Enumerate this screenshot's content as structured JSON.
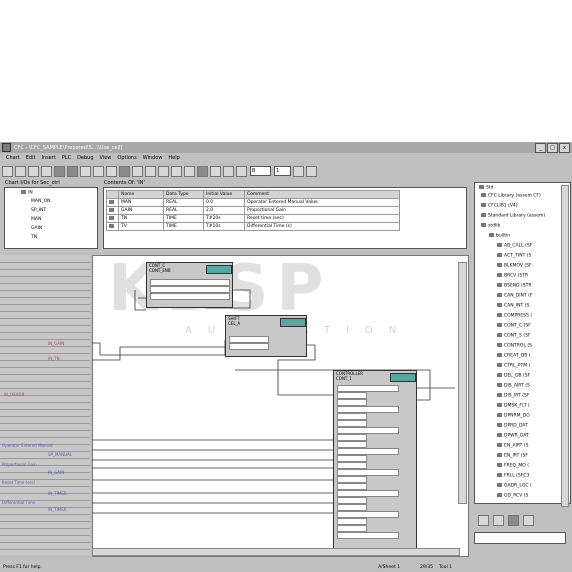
{
  "window": {
    "title": "CFC - \\CFC_SAMPLE\\Prepared\\S...\\\\Use_cell]",
    "controls": [
      "_",
      "□",
      "x"
    ]
  },
  "menu": [
    "Chart",
    "Edit",
    "Insert",
    "PLC",
    "Debug",
    "View",
    "Options",
    "Window",
    "Help"
  ],
  "toolbar": {
    "combo1": "B",
    "combo2": "1"
  },
  "chart_panel": {
    "label": "Chart I/Os for Sec_ctrl",
    "items": [
      "MAN_ON",
      "SP_INT",
      "MAN",
      "GAIN",
      "TN"
    ]
  },
  "contents_panel": {
    "label": "Contents Of: 'IN'",
    "columns": [
      "Name",
      "Data Type",
      "Initial Value",
      "Comment"
    ],
    "rows": [
      [
        "MAN",
        "REAL",
        "0.0",
        "Operator Entered Manual Value"
      ],
      [
        "GAIN",
        "REAL",
        "2.0",
        "Proportional Gain"
      ],
      [
        "TN",
        "TIME",
        "T#20s",
        "Reset time (sec)"
      ],
      [
        "TV",
        "TIME",
        "T#10s",
        "Differential Time (s)"
      ]
    ]
  },
  "library_panel": {
    "root": "Std",
    "items": [
      "CFC Library (assem CF)",
      "CFCLIB1 (V4)",
      "Standard Library (assem)",
      "stdlib",
      "builtin",
      "AB_CALL (SF",
      "ACT_TINT (S",
      "BLKMOV (SF",
      "BRCV (STR",
      "BSEND (STR",
      "CAN_DINT (F",
      "CAN_INT (S",
      "COMPRESS (",
      "CONT_C (SF",
      "CONT_S (SF",
      "CONTROL (S",
      "CREAT_DB (",
      "CTRL_PTM (",
      "DEL_DB (SF",
      "DIS_AIRT (S",
      "DIS_IRT (SF",
      "DMSK_FLT (",
      "DPNRM_DG",
      "DPRD_DAT",
      "DPWR_DAT",
      "EN_AIRT (S",
      "EN_IRT (SF",
      "FREQ_MO (",
      "FRLL (SFC3",
      "GADR_LGC (",
      "GD_RCV (S"
    ]
  },
  "blocks": [
    {
      "title": "CONT_C",
      "subtitle": "CONT_ENB"
    },
    {
      "title": "SHIFT",
      "subtitle": "CEL_A"
    },
    {
      "title": "CONTROLLER",
      "subtitle": "CONT_1"
    }
  ],
  "left_labels": {
    "pink": [
      "IN_GAIN",
      "IN_TN",
      "IN_DEADB"
    ],
    "blue": [
      "Operator Entered Manual",
      "SP_MANUAL",
      "Proportional Gain",
      "IN_GAIN",
      "Reset Time (sec)",
      "IN_TIMER",
      "Differential Time",
      "IN_TIMER"
    ]
  },
  "status": {
    "help": "Press F1 for help.",
    "sheet": "A/Sheet 1",
    "pos": "29/35",
    "mode": "Tool 1"
  },
  "watermark": {
    "big": "KBSP",
    "small": "AUTOMATION"
  }
}
